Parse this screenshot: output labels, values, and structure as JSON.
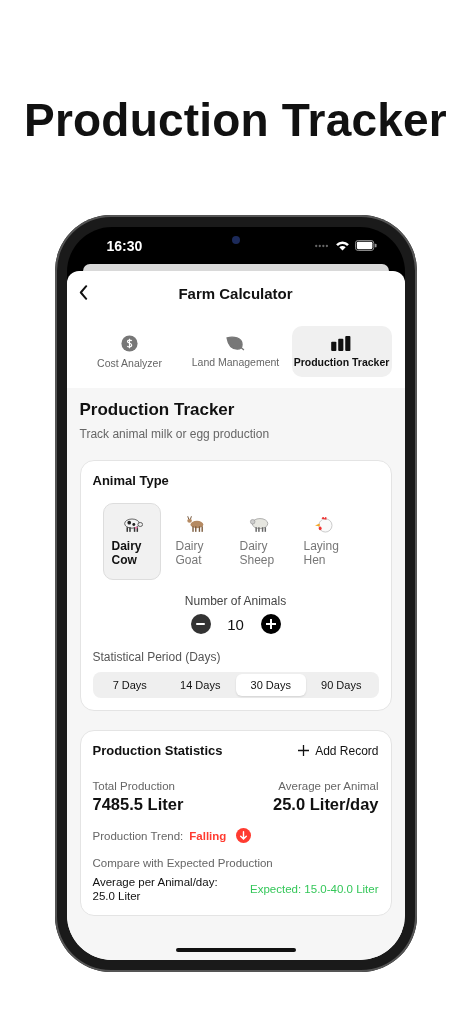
{
  "headline": "Production Tracker",
  "status_bar": {
    "time": "16:30"
  },
  "nav": {
    "title": "Farm Calculator"
  },
  "tabs": [
    {
      "label": "Cost Analyzer",
      "kind": "dollar",
      "selected": false
    },
    {
      "label": "Land Management",
      "kind": "leaf",
      "selected": false
    },
    {
      "label": "Production Tracker",
      "kind": "bars",
      "selected": true
    }
  ],
  "section": {
    "title": "Production Tracker",
    "subtitle": "Track animal milk or egg production"
  },
  "animal_type": {
    "title": "Animal Type",
    "animals": [
      {
        "label": "Dairy Cow",
        "kind": "cow",
        "selected": true
      },
      {
        "label": "Dairy Goat",
        "kind": "goat",
        "selected": false
      },
      {
        "label": "Dairy Sheep",
        "kind": "sheep",
        "selected": false
      },
      {
        "label": "Laying Hen",
        "kind": "hen",
        "selected": false
      }
    ]
  },
  "count": {
    "label": "Number of Animals",
    "value": "10"
  },
  "period": {
    "label": "Statistical Period (Days)",
    "options": [
      {
        "label": "7 Days",
        "selected": false
      },
      {
        "label": "14 Days",
        "selected": false
      },
      {
        "label": "30 Days",
        "selected": true
      },
      {
        "label": "90 Days",
        "selected": false
      }
    ]
  },
  "stats": {
    "title": "Production Statistics",
    "add_label": "Add Record",
    "total_label": "Total Production",
    "total": "7485.5 Liter",
    "avg_label": "Average per Animal",
    "avg": "25.0 Liter/day",
    "trend_label": "Production Trend:",
    "trend": "Falling",
    "trend_falling": true,
    "compare_label": "Compare with Expected Production",
    "compare_value": "Average per Animal/day: 25.0 Liter",
    "expected": "Expected: 15.0-40.0 Liter"
  }
}
